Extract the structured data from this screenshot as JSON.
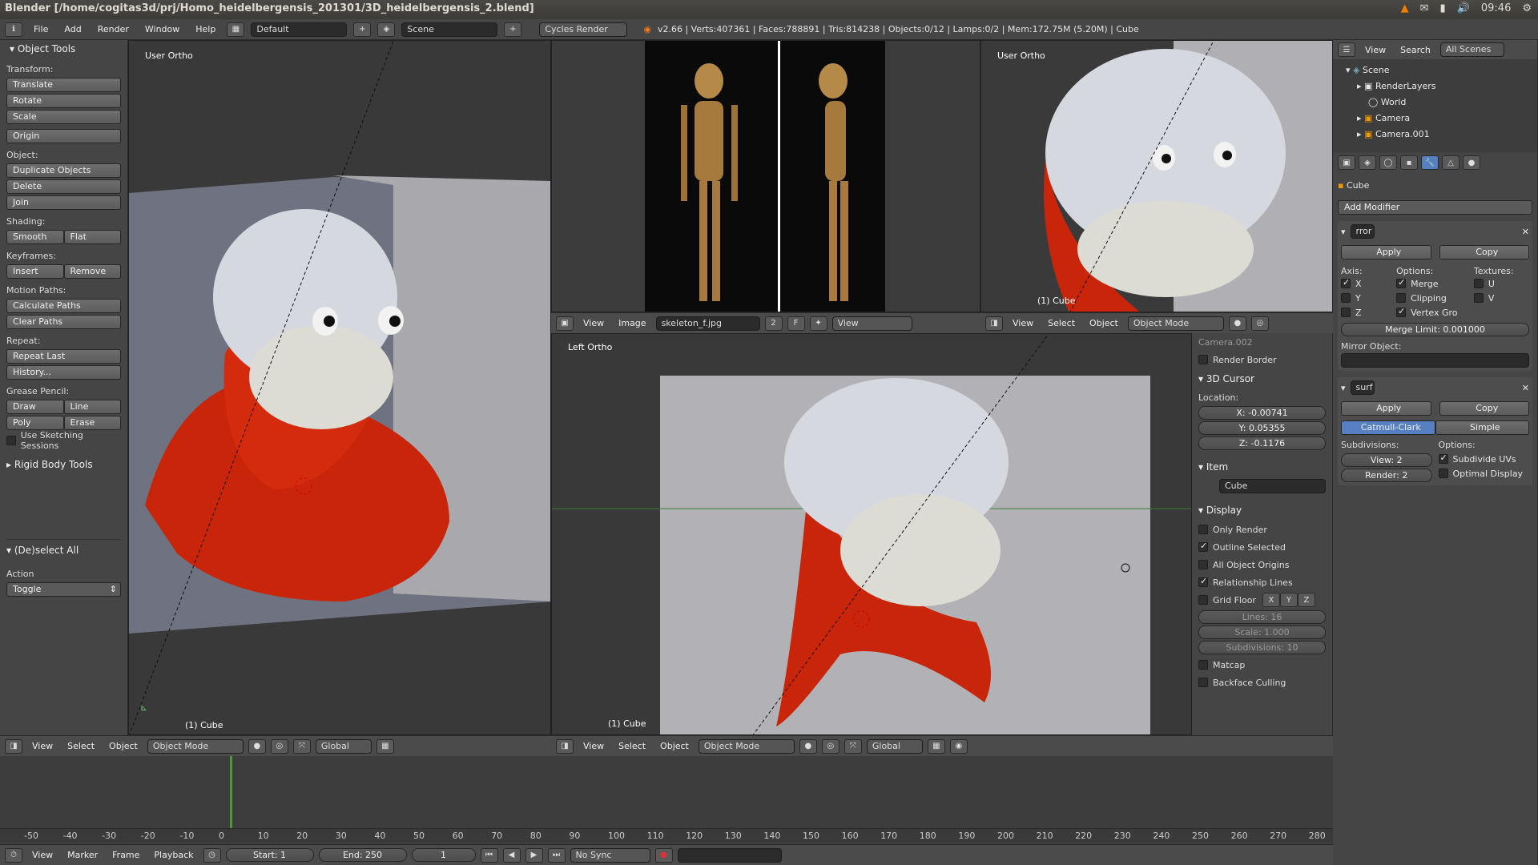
{
  "titlebar": {
    "title": "Blender [/home/cogitas3d/prj/Homo_heidelbergensis_201301/3D_heidelbergensis_2.blend]",
    "clock": "09:46"
  },
  "infobar": {
    "menus": [
      "File",
      "Add",
      "Render",
      "Window",
      "Help"
    ],
    "layout": "Default",
    "scene": "Scene",
    "engine": "Cycles Render",
    "stats": "v2.66 | Verts:407361 | Faces:788891 | Tris:814238 | Objects:0/12 | Lamps:0/2 | Mem:172.75M (5.20M) | Cube"
  },
  "toolshelf": {
    "header": "Object Tools",
    "transform_label": "Transform:",
    "translate": "Translate",
    "rotate": "Rotate",
    "scale": "Scale",
    "origin": "Origin",
    "object_label": "Object:",
    "duplicate": "Duplicate Objects",
    "delete": "Delete",
    "join": "Join",
    "shading_label": "Shading:",
    "smooth": "Smooth",
    "flat": "Flat",
    "keyframes_label": "Keyframes:",
    "insert": "Insert",
    "remove": "Remove",
    "motion_label": "Motion Paths:",
    "calc_paths": "Calculate Paths",
    "clear_paths": "Clear Paths",
    "repeat_label": "Repeat:",
    "repeat_last": "Repeat Last",
    "history": "History...",
    "grease_label": "Grease Pencil:",
    "draw": "Draw",
    "line": "Line",
    "poly": "Poly",
    "erase": "Erase",
    "sketching": "Use Sketching Sessions",
    "rigid": "Rigid Body Tools",
    "deselect_header": "(De)select All",
    "action_label": "Action",
    "action_value": "Toggle"
  },
  "viewport_left": {
    "title": "User Ortho",
    "object": "(1) Cube"
  },
  "viewport_topright": {
    "title": "User Ortho",
    "object": "(1) Cube"
  },
  "viewport_bottom": {
    "title": "Left Ortho",
    "object": "(1) Cube"
  },
  "viewheader": {
    "view": "View",
    "select": "Select",
    "object": "Object",
    "mode": "Object Mode",
    "orientation": "Global"
  },
  "imageeditor": {
    "view": "View",
    "image": "Image",
    "file": "skeleton_f.jpg",
    "users": "2",
    "fake": "F",
    "view2": "View"
  },
  "npanel": {
    "camera": "Camera.002",
    "render_border": "Render Border",
    "cursor_header": "3D Cursor",
    "location_label": "Location:",
    "x": "X: -0.00741",
    "y": "Y: 0.05355",
    "z": "Z: -0.1176",
    "item_header": "Item",
    "item_name": "Cube",
    "display_header": "Display",
    "only_render": "Only Render",
    "outline_selected": "Outline Selected",
    "all_origins": "All Object Origins",
    "relationship_lines": "Relationship Lines",
    "grid_floor": "Grid Floor",
    "gx": "X",
    "gy": "Y",
    "gz": "Z",
    "lines": "Lines: 16",
    "grid_scale": "Scale: 1.000",
    "subdivisions": "Subdivisions: 10",
    "matcap": "Matcap",
    "backface": "Backface Culling"
  },
  "outliner": {
    "view": "View",
    "search": "Search",
    "scenes": "All Scenes",
    "items": [
      "Scene",
      "RenderLayers",
      "World",
      "Camera",
      "Camera.001"
    ]
  },
  "properties": {
    "object": "Cube",
    "add_modifier": "Add Modifier",
    "mirror": {
      "name": "rror",
      "apply": "Apply",
      "copy": "Copy",
      "axis_label": "Axis:",
      "options_label": "Options:",
      "textures_label": "Textures:",
      "x": "X",
      "y": "Y",
      "z": "Z",
      "merge": "Merge",
      "clipping": "Clipping",
      "vertex_gro": "Vertex Gro",
      "u": "U",
      "v": "V",
      "merge_limit": "Merge Limit: 0.001000",
      "mirror_object": "Mirror Object:"
    },
    "subsurf": {
      "name": "surf",
      "apply": "Apply",
      "copy": "Copy",
      "catmull": "Catmull-Clark",
      "simple": "Simple",
      "subdivisions_label": "Subdivisions:",
      "options_label": "Options:",
      "view": "View: 2",
      "render": "Render: 2",
      "subdivide_uvs": "Subdivide UVs",
      "optimal_display": "Optimal Display"
    }
  },
  "timeline": {
    "ruler": [
      "-50",
      "-40",
      "-30",
      "-20",
      "-10",
      "0",
      "10",
      "20",
      "30",
      "40",
      "50",
      "60",
      "70",
      "80",
      "90",
      "100",
      "110",
      "120",
      "130",
      "140",
      "150",
      "160",
      "170",
      "180",
      "190",
      "200",
      "210",
      "220",
      "230",
      "240",
      "250",
      "260",
      "270",
      "280"
    ],
    "view": "View",
    "marker": "Marker",
    "frame": "Frame",
    "playback": "Playback",
    "start": "Start: 1",
    "end": "End: 250",
    "current": "1",
    "sync": "No Sync"
  }
}
